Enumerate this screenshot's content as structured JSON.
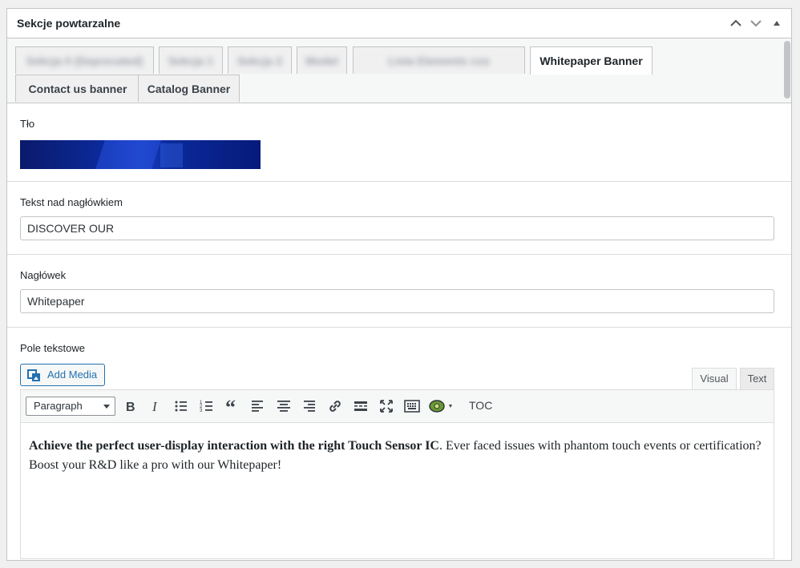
{
  "panel": {
    "title": "Sekcje powtarzalne"
  },
  "tabs": [
    {
      "label": "Sekcja 0 (Deprecated)",
      "blurred": true
    },
    {
      "label": "Sekcja 1",
      "blurred": true
    },
    {
      "label": "Sekcja 2",
      "blurred": true
    },
    {
      "label": "Model",
      "blurred": true
    },
    {
      "label": "Lista Elements cos",
      "blurred": true
    },
    {
      "label": "Whitepaper Banner",
      "active": true
    },
    {
      "label": "Contact us banner"
    },
    {
      "label": "Catalog Banner"
    }
  ],
  "fields": {
    "background": {
      "label": "Tło"
    },
    "overline": {
      "label": "Tekst nad nagłówkiem",
      "value": "DISCOVER OUR"
    },
    "heading": {
      "label": "Nagłówek",
      "value": "Whitepaper"
    },
    "textarea": {
      "label": "Pole tekstowe"
    }
  },
  "editor": {
    "add_media": "Add Media",
    "mode_visual": "Visual",
    "mode_text": "Text",
    "format": "Paragraph",
    "toc": "TOC",
    "content_bold": "Achieve the perfect user-display interaction with the right Touch Sensor IC",
    "content_rest": ". Ever faced issues with phantom touch events or certification? Boost your R&D like a pro with our Whitepaper!"
  },
  "icons": [
    "chevron-up-icon",
    "chevron-down-icon",
    "triangle-up-icon",
    "media-icon",
    "bold-icon",
    "italic-icon",
    "bullet-list-icon",
    "numbered-list-icon",
    "blockquote-icon",
    "align-left-icon",
    "align-center-icon",
    "align-right-icon",
    "link-icon",
    "read-more-icon",
    "fullscreen-icon",
    "toolbar-toggle-icon",
    "plugin-icon"
  ],
  "colors": {
    "accent": "#2271b1",
    "border": "#c3c4c7"
  }
}
